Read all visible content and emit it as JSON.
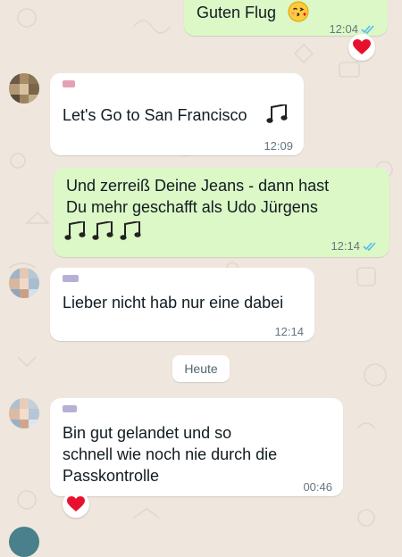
{
  "theme": {
    "background": "#efe7dd",
    "incoming_bubble": "#ffffff",
    "outgoing_bubble": "#dcf8c6",
    "read_tick_color": "#53bdeb",
    "heart_color": "#e8112d"
  },
  "messages": [
    {
      "direction": "outgoing",
      "text": "Guten Flug",
      "emoji": "kissing-face-emoji",
      "time": "12:04",
      "status": "read",
      "reaction": "heart"
    },
    {
      "direction": "incoming",
      "text": "Let's Go to San Francisco",
      "emoji": "musical-notes-emoji",
      "time": "12:09"
    },
    {
      "direction": "outgoing",
      "text": "Und zerreiß Deine Jeans - dann hast\nDu mehr geschafft als Udo Jürgens",
      "emoji": "musical-notes-emoji",
      "time": "12:14",
      "status": "read"
    },
    {
      "direction": "incoming",
      "text": "Lieber nicht hab nur eine dabei",
      "time": "12:14"
    },
    {
      "direction": "incoming",
      "text": "Bin gut gelandet und so\nschnell wie noch nie durch die\nPasskontrolle",
      "time": "00:46",
      "reaction": "heart"
    }
  ],
  "date_separator": "Heute"
}
